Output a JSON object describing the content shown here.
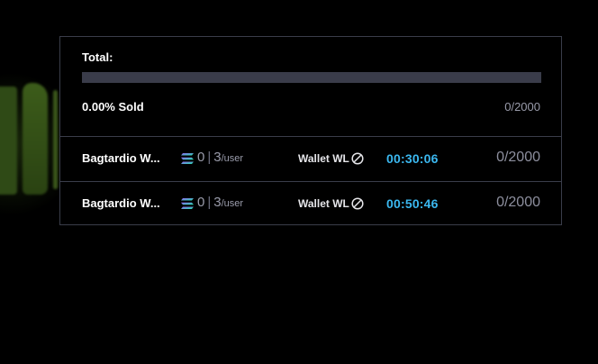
{
  "total": {
    "label": "Total:",
    "progress_fraction": 0.0,
    "sold_text": "0.00% Sold",
    "count": "0/2000"
  },
  "phases": [
    {
      "name": "Bagtardio W...",
      "minted": "0",
      "limit": "3",
      "limit_unit": "/user",
      "wl_label": "Wallet WL",
      "timer": "00:30:06",
      "count": "0/2000"
    },
    {
      "name": "Bagtardio W...",
      "minted": "0",
      "limit": "3",
      "limit_unit": "/user",
      "wl_label": "Wallet WL",
      "timer": "00:50:46",
      "count": "0/2000"
    }
  ],
  "icons": {
    "currency": "solana-icon",
    "restriction": "ban-icon"
  },
  "colors": {
    "timer": "#3bb8f0",
    "track": "#3a3c4a",
    "border": "#3a3d4a"
  }
}
